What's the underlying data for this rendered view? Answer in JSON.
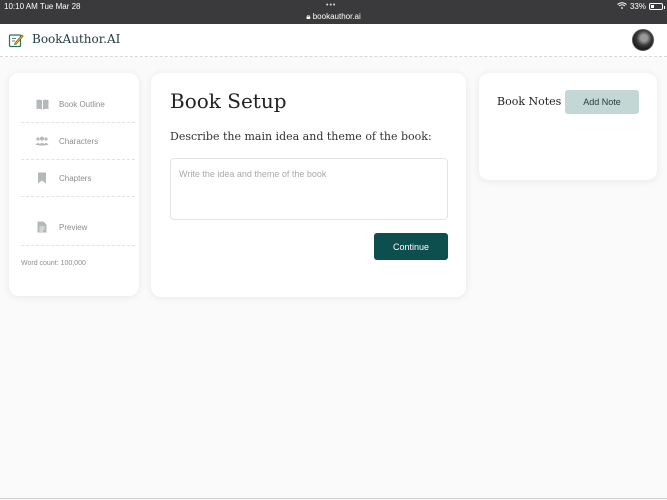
{
  "status_bar": {
    "time": "10:10 AM   Tue Mar 28",
    "url": "bookauthor.ai",
    "battery": "33%",
    "battery_level": 0.33
  },
  "header": {
    "app_title": "BookAuthor.AI"
  },
  "sidebar": {
    "items": [
      {
        "label": "Book Outline",
        "icon": "book-open-icon"
      },
      {
        "label": "Characters",
        "icon": "people-icon"
      },
      {
        "label": "Chapters",
        "icon": "bookmark-icon"
      },
      {
        "label": "Preview",
        "icon": "document-icon"
      }
    ],
    "word_count": "Word count: 100,000"
  },
  "main": {
    "title": "Book Setup",
    "prompt": "Describe the main idea and theme of the book:",
    "input_placeholder": "Write the idea and theme of the book",
    "input_value": "",
    "continue_label": "Continue"
  },
  "notes": {
    "title": "Book Notes",
    "add_label": "Add Note"
  },
  "colors": {
    "accent": "#0d4f4f",
    "accent_light": "#c3d8d4",
    "icon_gray": "#b3b8bb"
  }
}
